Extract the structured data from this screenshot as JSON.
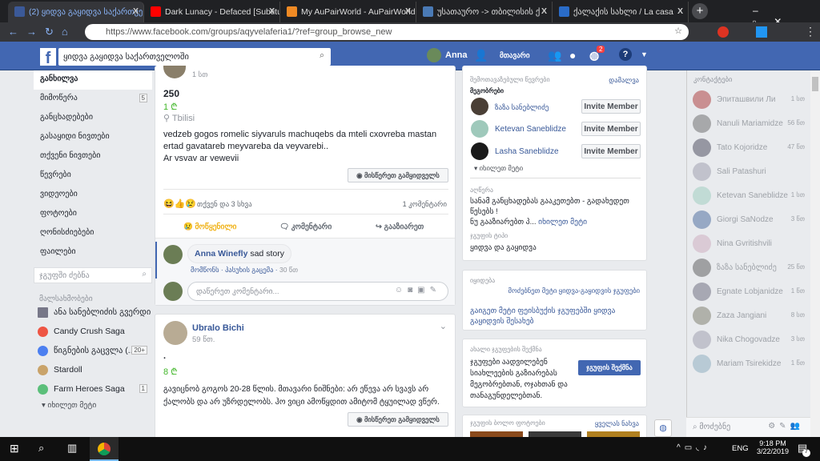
{
  "browser": {
    "tabs": [
      {
        "title": "(2) ყიდვა გაყიდვა საქართველოში",
        "color": "#3b5998"
      },
      {
        "title": "Dark Lunacy - Defaced [Subtitulado]",
        "color": "#ff0000"
      },
      {
        "title": "My AuPairWorld - AuPairWorld",
        "color": "#f08a24"
      },
      {
        "title": "უსათაურო -> თბილისის ქ",
        "color": "#4a7ab5"
      },
      {
        "title": "ქალაქის სახლი / La casa",
        "color": "#2a6cc8"
      }
    ],
    "close": "X",
    "new_tab": "+",
    "url": "https://www.facebook.com/groups/aqyvelaferia1/?ref=group_browse_new"
  },
  "fb": {
    "search": "ყიდვა გაყიდვა საქართველოში",
    "user": "Anna",
    "home": "მთავარი",
    "notif_count": "2"
  },
  "leftnav": {
    "items": [
      {
        "label": "განხილვა"
      },
      {
        "label": "მიმოწერა",
        "badge": "5"
      },
      {
        "label": "განცხადებები"
      },
      {
        "label": "გასაყიდი ნივთები"
      },
      {
        "label": "თქვენი ნივთები"
      },
      {
        "label": "წევრები"
      },
      {
        "label": "ვიდეოები"
      },
      {
        "label": "ფოტოები"
      },
      {
        "label": "ღონისძიებები"
      },
      {
        "label": "ფაილები"
      }
    ],
    "search_placeholder": "ჯგუფში ძებნა",
    "shortcuts_title": "მალსახმობები",
    "shortcuts": [
      {
        "label": "ანა სანებლიძის გვერდი"
      },
      {
        "label": "Candy Crush Saga"
      },
      {
        "label": "წიგნების გაცვლა (...",
        "badge": "20+"
      },
      {
        "label": "Stardoll"
      },
      {
        "label": "Farm Heroes Saga",
        "badge": "1"
      }
    ],
    "see_more": "იხილეთ მეტი"
  },
  "post1": {
    "time": "1 სთ",
    "title": "250",
    "price": "1 ₾",
    "location": "Tbilisi",
    "text1": "vedzeb gogos romelic siyvaruls machuqebs da mteli cxovreba mastan ertad gavatareb meyvareba da veyvarebi..",
    "text2": "Ar vsvav ar vewevii",
    "message_seller": "მისწერეთ გამყიდველს",
    "reactions": "თქვენ და 3 სხვა",
    "comments": "1 კომენტარი",
    "actions": {
      "sad": "მოწყენილი",
      "comment": "კომენტარი",
      "share": "გააზიარეთ"
    },
    "comment": {
      "author": "Anna Winefly",
      "text": "sad story",
      "like": "მომწონს",
      "reply": "პასუხის გაცემა",
      "time": "30 წთ"
    },
    "comment_placeholder": "დაწერეთ კომენტარი..."
  },
  "post2": {
    "author": "Ubralo Bichi",
    "time": "59 წთ.",
    "title": ".",
    "price": "8 ₾",
    "text": "გავიცნობ გოგოს 20-28 წლის. მთავარი ნიშნები: არ ეწევა არ სვავს არ ქალობს და არ უზრდელობს. ჰო ვიცი ამოწყდით ამიტომ ტყუილად ვწერ.",
    "message_seller": "მისწერეთ გამყიდველს"
  },
  "right": {
    "suggested": "შემოთავაზებული წევრები",
    "hide": "დამალვა",
    "friends": "მეგობრები",
    "members": [
      {
        "name": "ზაზა სანებლიძე"
      },
      {
        "name": "Ketevan Saneblidze"
      },
      {
        "name": "Lasha Saneblidze"
      }
    ],
    "invite": "Invite Member",
    "see_more": "იხილეთ მეტი",
    "desc_label": "აღწერა",
    "desc": "სანამ განცხადებას გააკეთებთ - გადახედეთ წესებს !",
    "desc2": "ნუ გააზიარებთ პ...",
    "type_label": "ჯგუფის ტიპი",
    "type": "ყიდვა და გაყიდვა",
    "sale_label": "იყიდება",
    "find_more": "მოძებნეთ მეტი ყიდვა-გაყიდვის ჯგუფები",
    "learn_more": "გაიგეთ მეტი ფეისბუქის ჯგუფებში ყიდვა გაყიდვის შესახებ",
    "create_label": "ახალი ჯგუფების შექმნა",
    "create_text": "ჯგუფები აადვილებენ სიახლეების გაზიარებას მეგობრებთან, ოჯახთან და თანაგუნდელებთან.",
    "create_btn": "ჯგუფის შექმნა",
    "photos_label": "ჯგუფის ბოლო ფოტოები",
    "see_all": "ყველას ნახვა"
  },
  "chat": {
    "title": "კონტაქტები",
    "search": "მოძებნე",
    "contacts": [
      {
        "name": "Эпиташвили Ли",
        "time": "1 სთ"
      },
      {
        "name": "Nanuli Mariamidze",
        "time": "56 წთ"
      },
      {
        "name": "Tato Kojoridze",
        "time": "47 წთ"
      },
      {
        "name": "Sali Patashuri",
        "time": ""
      },
      {
        "name": "Ketevan Saneblidze",
        "time": "1 სთ"
      },
      {
        "name": "Giorgi SaNodze",
        "time": "3 წთ"
      },
      {
        "name": "Nina Gvritishvili",
        "time": ""
      },
      {
        "name": "ზაზა სანებლიძე",
        "time": "25 წთ"
      },
      {
        "name": "Egnate Lobjanidze",
        "time": "1 წთ"
      },
      {
        "name": "Zaza Jangiani",
        "time": "8 სთ"
      },
      {
        "name": "Nika Chogovadze",
        "time": "3 სთ"
      },
      {
        "name": "Mariam Tsirekidze",
        "time": "1 წთ"
      }
    ]
  },
  "taskbar": {
    "lang": "ENG",
    "time": "9:18 PM",
    "date": "3/22/2019",
    "notif": "7"
  }
}
